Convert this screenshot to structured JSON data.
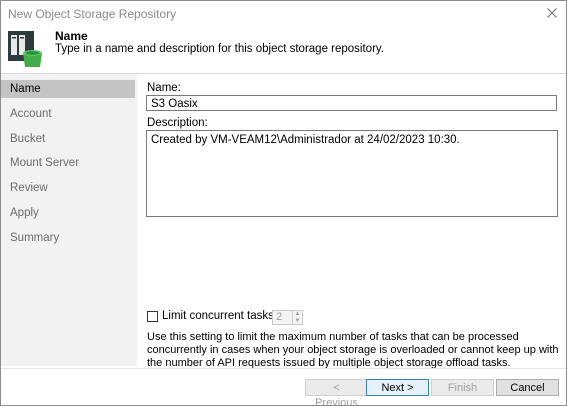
{
  "window": {
    "title": "New Object Storage Repository"
  },
  "header": {
    "title": "Name",
    "description": "Type in a name and description for this object storage repository."
  },
  "sidebar": {
    "items": [
      {
        "label": "Name"
      },
      {
        "label": "Account"
      },
      {
        "label": "Bucket"
      },
      {
        "label": "Mount Server"
      },
      {
        "label": "Review"
      },
      {
        "label": "Apply"
      },
      {
        "label": "Summary"
      }
    ],
    "active_index": 0
  },
  "form": {
    "name_label": "Name:",
    "name_value": "S3 Oasix",
    "description_label": "Description:",
    "description_value": "Created by VM-VEAM12\\Administrador at 24/02/2023 10:30.",
    "limit_label": "Limit concurrent tasks to:",
    "limit_checked": false,
    "limit_value": "2",
    "help_text": "Use this setting to limit the maximum number of tasks that can be processed concurrently in cases when your object storage is overloaded or cannot keep up with the number of API requests issued by multiple object storage offload tasks."
  },
  "footer": {
    "previous_label": "< Previous",
    "next_label": "Next >",
    "finish_label": "Finish",
    "cancel_label": "Cancel"
  },
  "icons": {
    "close": "close-icon",
    "header": "object-storage-repository-icon"
  },
  "colors": {
    "sidebar_bg": "#f2f2f2",
    "sidebar_active": "#c4c4c4",
    "icon_green": "#3fae49",
    "icon_dark": "#2d3b3f"
  }
}
